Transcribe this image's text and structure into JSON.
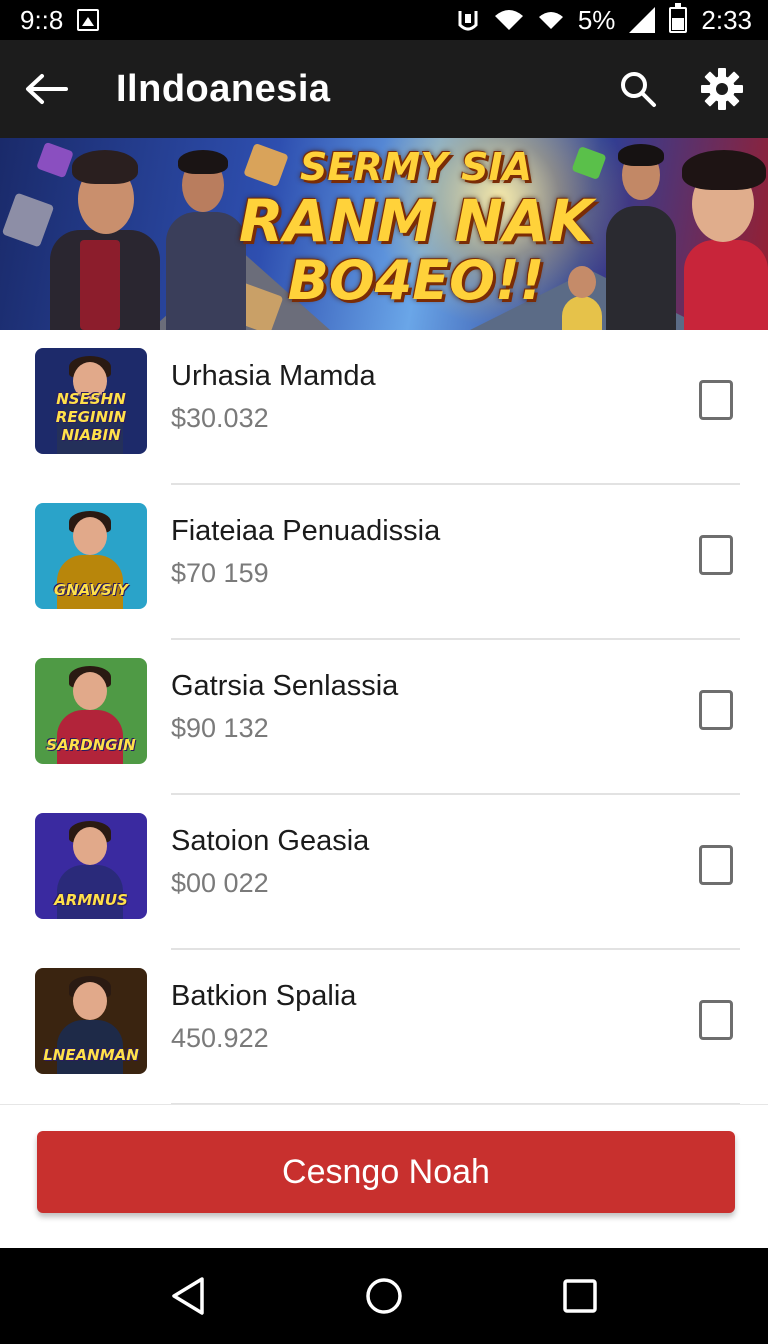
{
  "status_bar": {
    "left_time": "9::8",
    "battery_percent": "5%",
    "clock": "2:33",
    "icons": [
      "image-icon",
      "alert-icon",
      "wifi-icon",
      "wifi-icon",
      "signal-icon",
      "battery-icon"
    ]
  },
  "app_bar": {
    "title": "Ilndoanesia",
    "icons": [
      "back-arrow-icon",
      "search-icon",
      "gear-icon"
    ]
  },
  "banner": {
    "line1": "SERMY SIA",
    "line2": "RANM NAK",
    "line3": "BO4EO!!"
  },
  "items": [
    {
      "title": "Urhasia Mamda",
      "price": "$30.032",
      "thumb_text": "NSESHN REGININ NIABIN",
      "thumb_bg": "#1d2a6a",
      "thumb_body": "#24305a",
      "checked": false
    },
    {
      "title": "Fiateiaa Penuadissia",
      "price": "$70 159",
      "thumb_text": "GNAVSIY",
      "thumb_bg": "#2aa3c9",
      "thumb_body": "#b8860b",
      "checked": false
    },
    {
      "title": "Gatrsia Senlassia",
      "price": "$90 132",
      "thumb_text": "SARDNGIN",
      "thumb_bg": "#4f9a45",
      "thumb_body": "#b2243a",
      "checked": false
    },
    {
      "title": "Satoion Geasia",
      "price": "$00 022",
      "thumb_text": "ARMNUS",
      "thumb_bg": "#3a2aa0",
      "thumb_body": "#2a2a7a",
      "checked": false
    },
    {
      "title": "Batkion Spalia",
      "price": "450.922",
      "thumb_text": "LNEANMAN",
      "thumb_bg": "#3a2410",
      "thumb_body": "#1e2a48",
      "checked": false
    }
  ],
  "primary_action": {
    "label": "Cesngo Noah"
  },
  "colors": {
    "app_bar": "#1c1c1c",
    "accent_button": "#c8302e",
    "banner_text": "#ffd23a"
  }
}
